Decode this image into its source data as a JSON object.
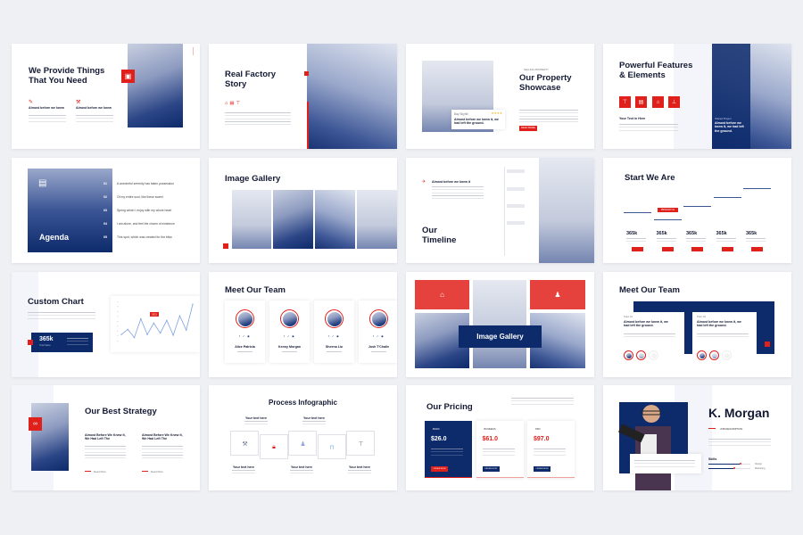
{
  "colors": {
    "navy": "#0d2a6b",
    "red": "#e0201b",
    "background": "#eef0f4"
  },
  "slides": {
    "provide": {
      "title": "We Provide Things That You Need",
      "features": [
        {
          "icon": "blueprint-icon",
          "label": "Almost before we knew"
        },
        {
          "icon": "tools-icon",
          "label": "Almost before we knew"
        }
      ],
      "badge_icon": "toolbox-icon"
    },
    "factory": {
      "title": "Real Factory Story",
      "icons": [
        "helmet-icon",
        "building-icon",
        "crane-icon"
      ]
    },
    "property": {
      "tagline": "SELLING PROPERTY",
      "title": "Our Property Showcase",
      "card_label": "Bay Skyhill",
      "card_text": "Almost before we knew it, we had left the ground.",
      "rating": 4,
      "button": "READ MORE"
    },
    "features": {
      "title": "Powerful Features & Elements",
      "icons": [
        "crane-icon",
        "building-icon",
        "helmet-icon",
        "tower-icon"
      ],
      "subtitle": "Your Text in Here",
      "overlay_label": "Shared Project",
      "overlay_text": "Almost before we knew it, we had left the ground."
    },
    "agenda": {
      "title": "Agenda",
      "items": [
        {
          "num": "01",
          "text": "A wonderful serenity has taken possession"
        },
        {
          "num": "02",
          "text": "Of my entire soul, like these sweet"
        },
        {
          "num": "03",
          "text": "Spring which I enjoy with my whole heart"
        },
        {
          "num": "04",
          "text": "I am alone, and feel the charm of existence"
        },
        {
          "num": "05",
          "text": "This spot, which was created for the bliss"
        }
      ]
    },
    "gallery": {
      "title": "Image Gallery"
    },
    "timeline": {
      "title": "Our Timeline",
      "heading": "Almost before we knew it"
    },
    "stats": {
      "title": "Start We Are",
      "tag": "PRODUCT 01",
      "values": [
        "365k",
        "365k",
        "365k",
        "365k",
        "365k"
      ],
      "levels": [
        0.45,
        0.35,
        0.55,
        0.68,
        0.82
      ]
    },
    "chart": {
      "title": "Custom Chart",
      "stat": "365k",
      "stat_label": "Total Sales",
      "tag": "2021",
      "values": [
        2,
        3.7,
        1,
        7.2,
        2,
        5.8,
        2.5,
        6.7,
        1.8,
        8.2,
        3.5,
        12
      ]
    },
    "team": {
      "title": "Meet Our Team",
      "members": [
        {
          "name": "Alice Patricia"
        },
        {
          "name": "Kenny Morgan"
        },
        {
          "name": "Sheena Liu"
        },
        {
          "name": "Josh T'Challe"
        }
      ]
    },
    "gallery2": {
      "title": "Image Gallery"
    },
    "team2": {
      "title": "Meet Our Team",
      "cards": [
        {
          "label": "Team 01",
          "heading": "Almost before we knew it, we had left the ground."
        },
        {
          "label": "Team 02",
          "heading": "Almost before we knew it, we had left the ground."
        }
      ]
    },
    "strategy": {
      "title": "Our Best Strategy",
      "columns": [
        {
          "heading": "Almost Before We Knew It, We Had Left The",
          "link": "Read More"
        },
        {
          "heading": "Almost Before We Knew It, We Had Left The",
          "link": "Read More"
        }
      ]
    },
    "process": {
      "title": "Process Infographic",
      "top_labels": [
        "Your text here",
        "Your text here"
      ],
      "bottom_labels": [
        "Your text here",
        "Your text here",
        "Your text here"
      ],
      "icons": [
        "hammer-icon",
        "lock-icon",
        "worker-icon",
        "barrier-icon",
        "crane-icon"
      ]
    },
    "pricing": {
      "title": "Our Pricing",
      "plans": [
        {
          "name": "BASIC",
          "price": "$26.0",
          "button": "ORDER NOW"
        },
        {
          "name": "BUSINESS",
          "price": "$61.0",
          "button": "ORDER NOW"
        },
        {
          "name": "PRO",
          "price": "$97.0",
          "button": "ORDER NOW"
        }
      ]
    },
    "profile": {
      "name": "K. Morgan",
      "job": "JOB DESCRIPTION",
      "skills_title": "Skills",
      "skills": [
        {
          "label": "Design",
          "level": 0.75
        },
        {
          "label": "Marketing",
          "level": 0.6
        }
      ]
    }
  }
}
